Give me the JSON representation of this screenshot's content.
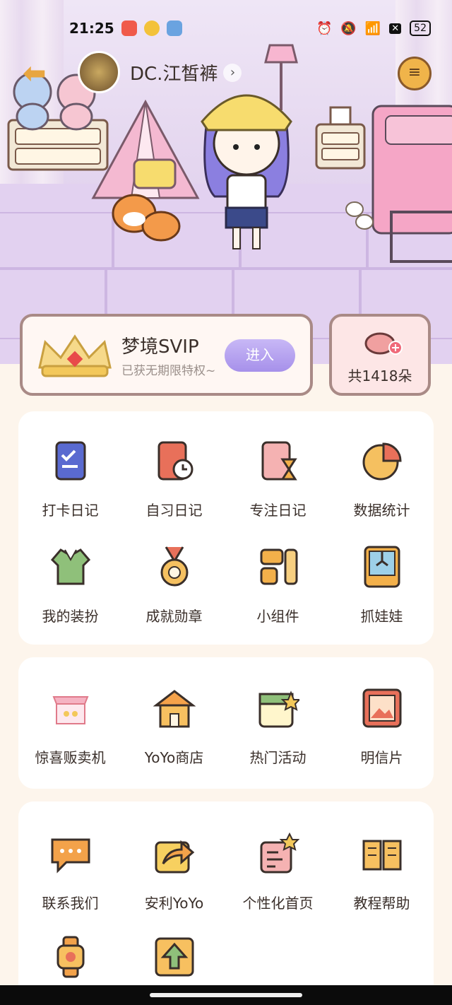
{
  "status_bar": {
    "time": "21:25",
    "battery": "52"
  },
  "profile": {
    "username": "DC.江皙裤"
  },
  "svip": {
    "title": "梦境SVIP",
    "subtitle": "已获无期限特权~",
    "enter_label": "进入"
  },
  "flowers": {
    "count_label": "共1418朵"
  },
  "panel1": {
    "items": [
      {
        "label": "打卡日记",
        "icon": "checkin-diary-icon"
      },
      {
        "label": "自习日记",
        "icon": "study-diary-icon"
      },
      {
        "label": "专注日记",
        "icon": "focus-diary-icon"
      },
      {
        "label": "数据统计",
        "icon": "statistics-icon"
      },
      {
        "label": "我的装扮",
        "icon": "outfit-icon"
      },
      {
        "label": "成就勋章",
        "icon": "medal-icon"
      },
      {
        "label": "小组件",
        "icon": "widget-icon"
      },
      {
        "label": "抓娃娃",
        "icon": "claw-machine-icon"
      }
    ]
  },
  "panel2": {
    "items": [
      {
        "label": "惊喜贩卖机",
        "icon": "vending-machine-icon"
      },
      {
        "label": "YoYo商店",
        "icon": "shop-icon"
      },
      {
        "label": "热门活动",
        "icon": "events-icon"
      },
      {
        "label": "明信片",
        "icon": "postcard-icon"
      }
    ]
  },
  "panel3": {
    "items": [
      {
        "label": "联系我们",
        "icon": "contact-icon"
      },
      {
        "label": "安利YoYo",
        "icon": "share-icon"
      },
      {
        "label": "个性化首页",
        "icon": "customize-home-icon"
      },
      {
        "label": "教程帮助",
        "icon": "tutorial-icon"
      },
      {
        "label": "",
        "icon": "watch-icon"
      },
      {
        "label": "",
        "icon": "update-icon"
      }
    ]
  },
  "colors": {
    "accent": "#a690ea",
    "panel_bg": "#ffffff",
    "page_bg": "#fdf5ec",
    "card_border": "#a98a86"
  }
}
